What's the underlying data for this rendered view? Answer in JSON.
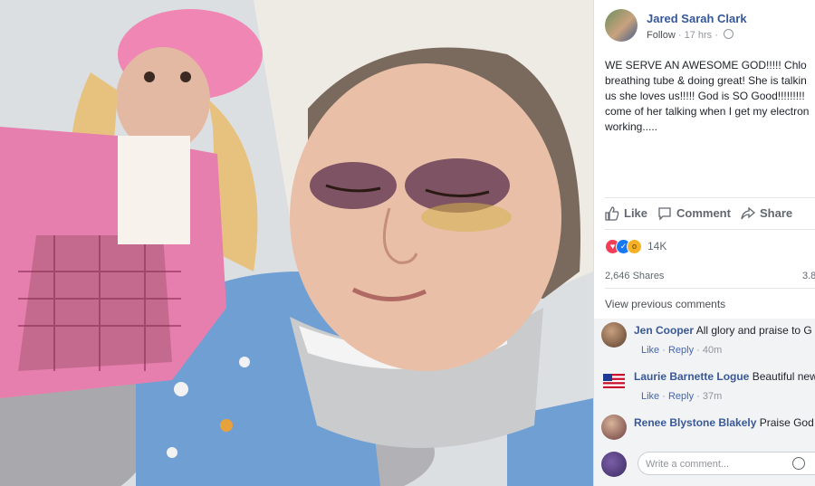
{
  "photo": {
    "description_icon": "photo-of-child-with-doll"
  },
  "post": {
    "author": "Jared Sarah Clark",
    "follow": "Follow",
    "time": "17 hrs",
    "text_lines": [
      "WE SERVE AN AWESOME GOD!!!!! Chlo",
      "breathing tube & doing great! She is talkin",
      "us she loves us!!!!! God is SO Good!!!!!!!!!",
      "come of her talking when I get my electron",
      "working....."
    ]
  },
  "actions": {
    "like": "Like",
    "comment": "Comment",
    "share": "Share"
  },
  "reactions": {
    "count": "14K",
    "icons": [
      "heart-icon",
      "like-icon",
      "wow-icon"
    ],
    "colors": [
      "#f33e58",
      "#1877f2",
      "#f7b125"
    ]
  },
  "shares": {
    "label": "2,646 Shares",
    "right": "3.8"
  },
  "view_previous": "View previous comments",
  "comments": [
    {
      "name": "Jen Cooper",
      "text": "All glory and praise to G",
      "like": "Like",
      "reply": "Reply",
      "time": "40m"
    },
    {
      "name": "Laurie Barnette Logue",
      "text": "Beautiful new",
      "like": "Like",
      "reply": "Reply",
      "time": "37m"
    },
    {
      "name": "Renee Blystone Blakely",
      "text": "Praise God",
      "like": "Like",
      "reply": "Reply",
      "time": ""
    }
  ],
  "composer": {
    "placeholder": "Write a comment..."
  }
}
